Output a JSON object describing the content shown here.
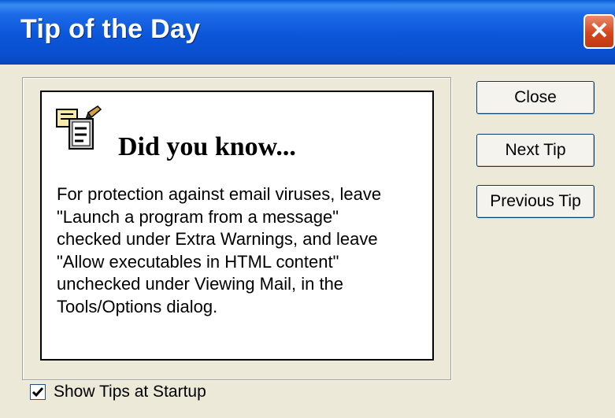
{
  "window": {
    "title": "Tip of the Day",
    "close_glyph": "✕"
  },
  "tip": {
    "icon": "tip-document-icon",
    "heading": "Did you know...",
    "lines": [
      "For protection against email viruses, leave",
      "\"Launch a program from a message\"",
      "checked under Extra Warnings, and leave",
      "\"Allow executables in HTML content\"",
      "unchecked under Viewing Mail, in the",
      "Tools/Options dialog."
    ]
  },
  "buttons": {
    "close_label": "Close",
    "next_label": "Next Tip",
    "previous_label": "Previous Tip"
  },
  "startup": {
    "label": "Show Tips at Startup",
    "checked": true
  }
}
